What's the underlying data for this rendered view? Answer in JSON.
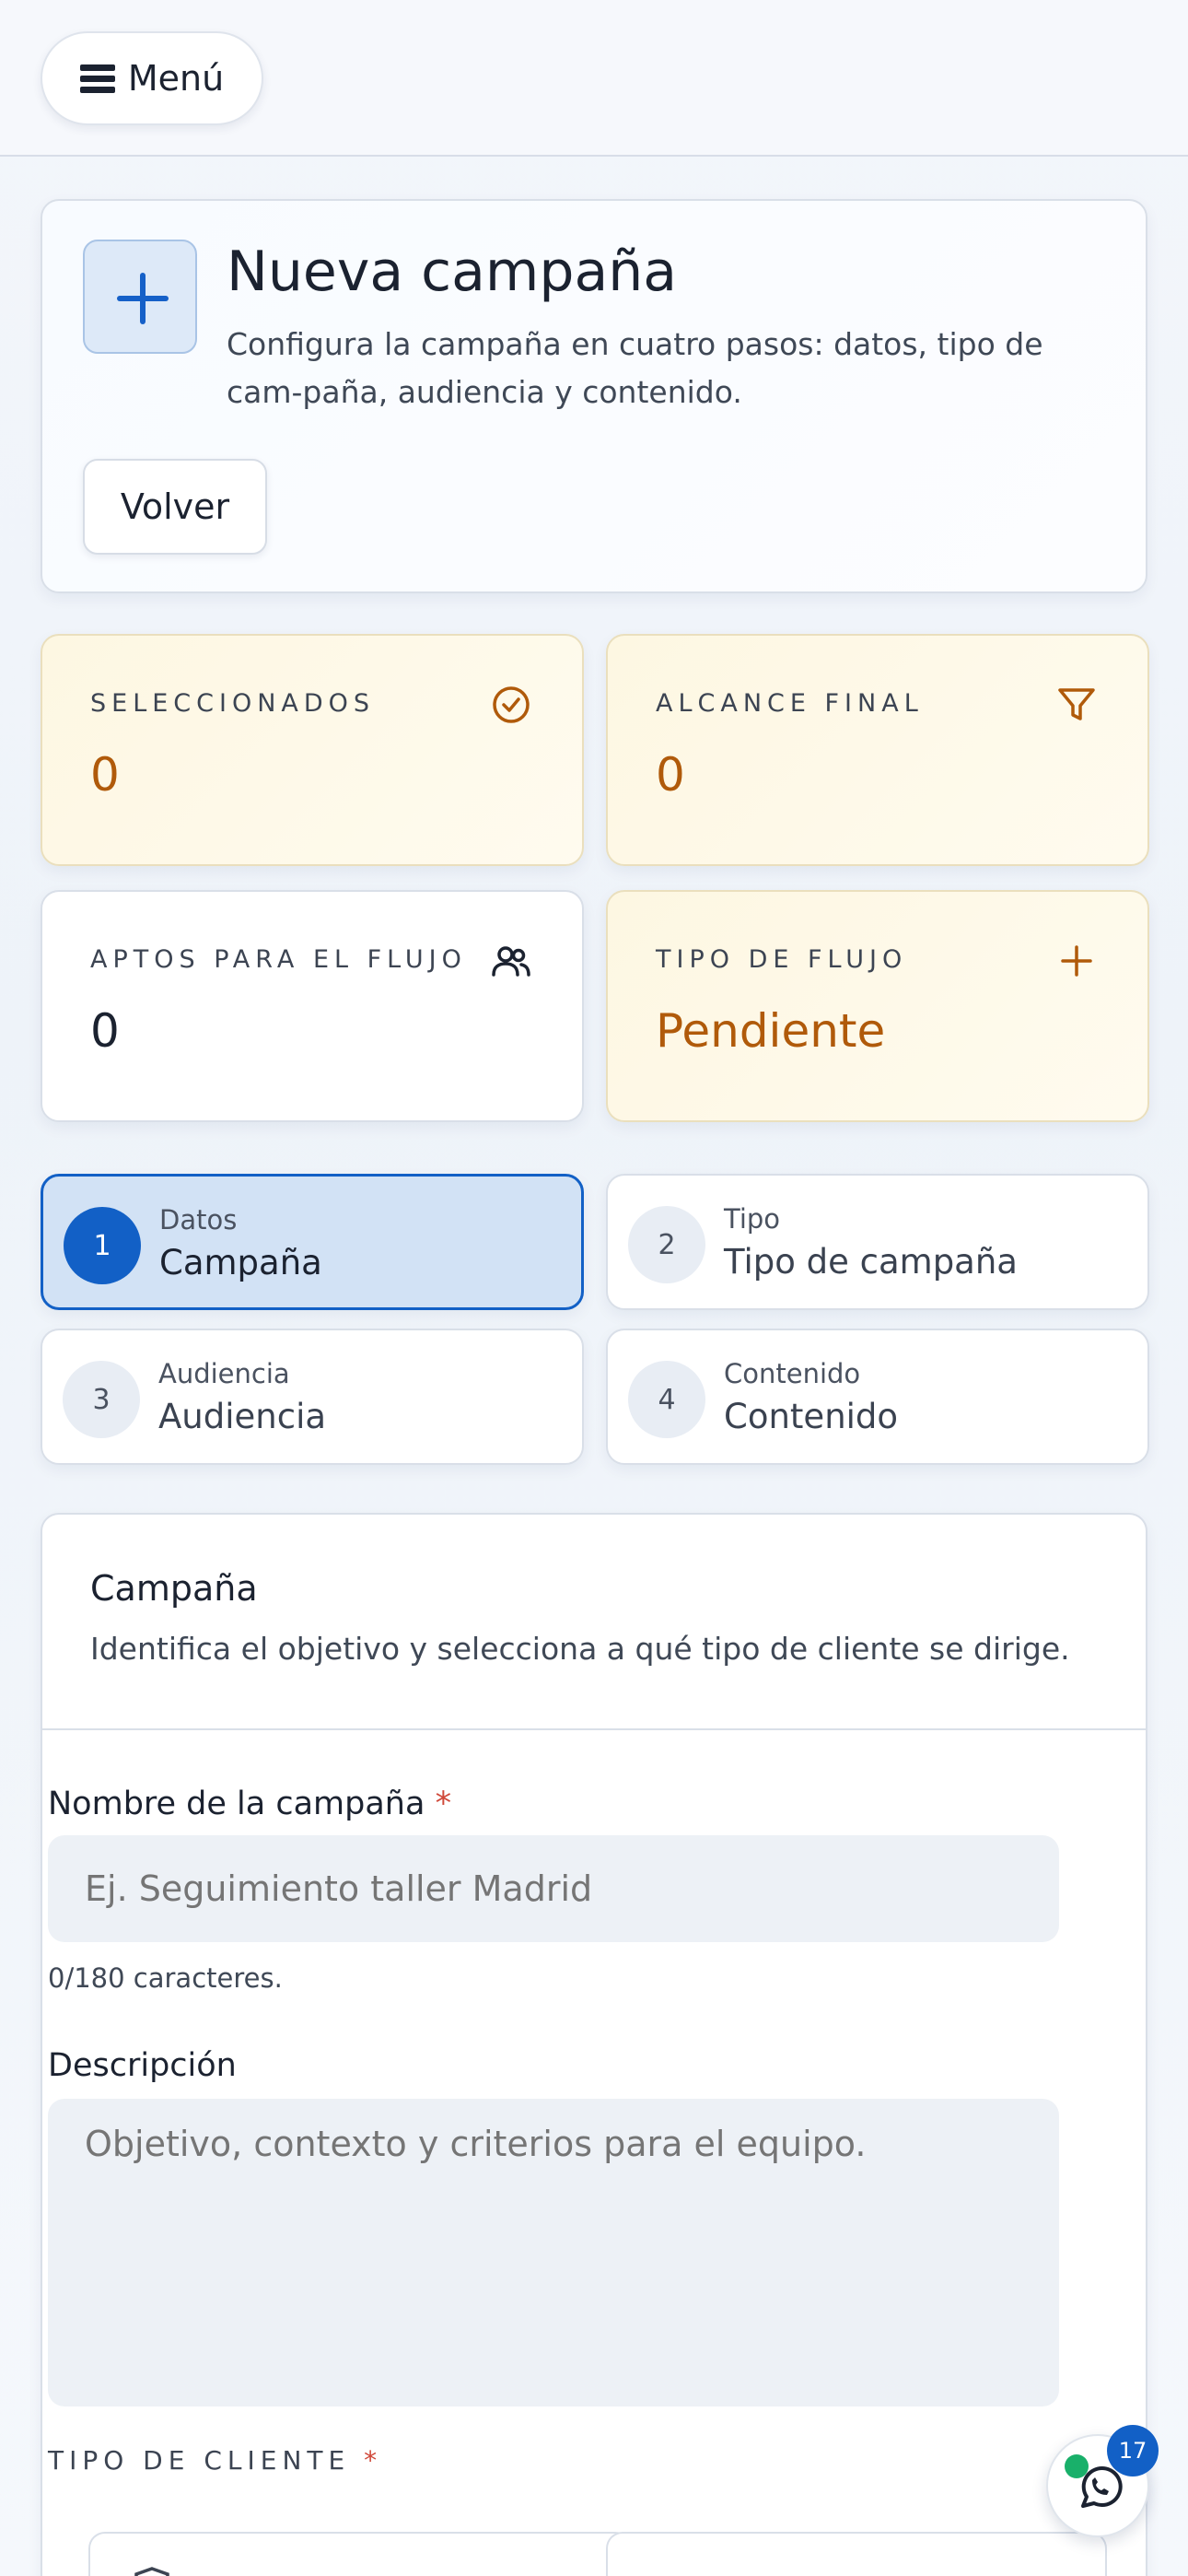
{
  "topbar": {
    "menu_label": "Menú"
  },
  "hero": {
    "title": "Nueva campaña",
    "description": "Configura la campaña en cuatro pasos: datos, tipo de cam-paña, audiencia y contenido.",
    "back_label": "Volver"
  },
  "stats": [
    {
      "label": "SELECCIONADOS",
      "value": "0",
      "icon": "check-circle-icon"
    },
    {
      "label": "ALCANCE FINAL",
      "value": "0",
      "icon": "filter-icon"
    },
    {
      "label": "APTOS PARA EL FLUJO",
      "value": "0",
      "icon": "users-icon"
    },
    {
      "label": "TIPO DE FLUJO",
      "value": "Pendiente",
      "icon": "plus-icon"
    }
  ],
  "steps": [
    {
      "num": "1",
      "small": "Datos",
      "big": "Campaña",
      "active": true
    },
    {
      "num": "2",
      "small": "Tipo",
      "big": "Tipo de campaña",
      "active": false
    },
    {
      "num": "3",
      "small": "Audiencia",
      "big": "Audiencia",
      "active": false
    },
    {
      "num": "4",
      "small": "Contenido",
      "big": "Contenido",
      "active": false
    }
  ],
  "form": {
    "title": "Campaña",
    "subtitle": "Identifica el objetivo y selecciona a qué tipo de cliente se dirige.",
    "name_label": "Nombre de la campaña",
    "required_mark": "*",
    "name_placeholder": "Ej. Seguimiento taller Madrid",
    "name_value": "",
    "char_count": "0/180 caracteres.",
    "desc_label": "Descripción",
    "desc_placeholder": "Objetivo, contexto y criterios para el equipo.",
    "desc_value": "",
    "client_type_label": "TIPO DE CLIENTE"
  },
  "chat": {
    "badge": "17"
  },
  "colors": {
    "accent": "#1260c6",
    "warm": "#b05a0a",
    "required": "#d0493a",
    "online": "#19b06a"
  }
}
